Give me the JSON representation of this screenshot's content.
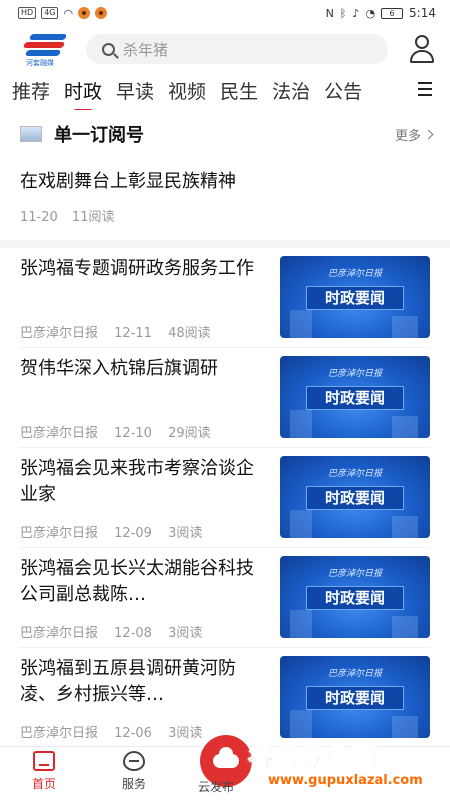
{
  "status_bar": {
    "left_badges": [
      "HD",
      "4G"
    ],
    "battery": "6",
    "time": "5:14"
  },
  "header": {
    "logo_text": "河套融媒",
    "search_placeholder": "杀年猪"
  },
  "tabs": [
    {
      "label": "推荐",
      "active": false
    },
    {
      "label": "时政",
      "active": true
    },
    {
      "label": "早读",
      "active": false
    },
    {
      "label": "视频",
      "active": false
    },
    {
      "label": "民生",
      "active": false
    },
    {
      "label": "法治",
      "active": false
    },
    {
      "label": "公告",
      "active": false
    }
  ],
  "subscription": {
    "title": "单一订阅号",
    "more_label": "更多"
  },
  "featured": {
    "title": "在戏剧舞台上彰显民族精神",
    "date": "11-20",
    "reads": "11阅读"
  },
  "news": [
    {
      "title": "张鸿福专题调研政务服务工作",
      "source": "巴彦淖尔日报",
      "date": "12-11",
      "reads": "48阅读",
      "thumb_caption": "巴彦淖尔日报",
      "thumb_label": "时政要闻"
    },
    {
      "title": "贺伟华深入杭锦后旗调研",
      "source": "巴彦淖尔日报",
      "date": "12-10",
      "reads": "29阅读",
      "thumb_caption": "巴彦淖尔日报",
      "thumb_label": "时政要闻"
    },
    {
      "title": "张鸿福会见来我市考察洽谈企业家",
      "source": "巴彦淖尔日报",
      "date": "12-09",
      "reads": "3阅读",
      "thumb_caption": "巴彦淖尔日报",
      "thumb_label": "时政要闻"
    },
    {
      "title": "张鸿福会见长兴太湖能谷科技公司副总裁陈…",
      "source": "巴彦淖尔日报",
      "date": "12-08",
      "reads": "3阅读",
      "thumb_caption": "巴彦淖尔日报",
      "thumb_label": "时政要闻"
    },
    {
      "title": "张鸿福到五原县调研黄河防凌、乡村振兴等…",
      "source": "巴彦淖尔日报",
      "date": "12-06",
      "reads": "3阅读",
      "thumb_caption": "巴彦淖尔日报",
      "thumb_label": "时政要闻"
    }
  ],
  "bottom_nav": {
    "home": "首页",
    "service": "服务",
    "publish": "云发布"
  },
  "watermark": {
    "main": "谷普软件园",
    "sub": "www.gupuxlazal.com"
  },
  "colors": {
    "accent": "#d7272a",
    "thumb_blue": "#1a5cc6",
    "watermark": "#ff6a00"
  }
}
